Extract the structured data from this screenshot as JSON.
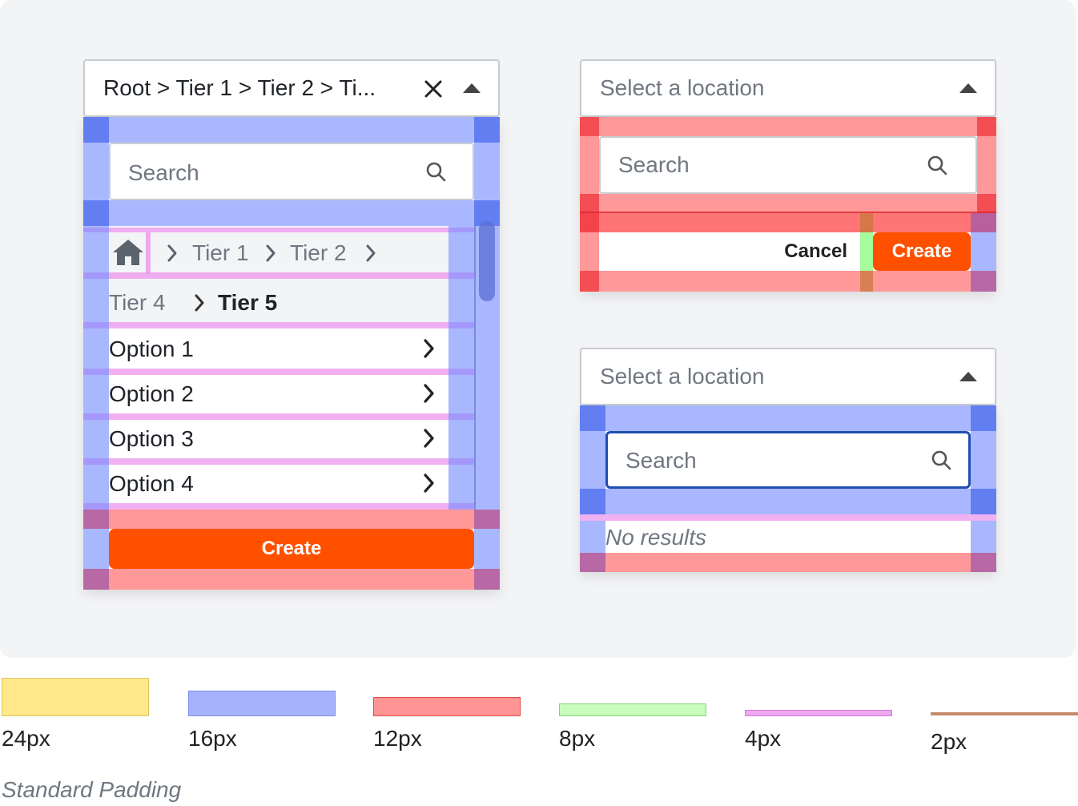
{
  "left_panel": {
    "trigger_value": "Root > Tier 1 > Tier 2 > Ti...",
    "search_placeholder": "Search",
    "breadcrumb": [
      "Tier 1",
      "Tier 2"
    ],
    "breadcrumb_row2": {
      "previous": "Tier 4",
      "current": "Tier 5"
    },
    "options": [
      "Option 1",
      "Option 2",
      "Option 3",
      "Option 4"
    ],
    "create_label": "Create"
  },
  "top_right_panel": {
    "trigger_placeholder": "Select a location",
    "search_placeholder": "Search",
    "cancel_label": "Cancel",
    "create_label": "Create"
  },
  "bottom_right_panel": {
    "trigger_placeholder": "Select a location",
    "search_placeholder": "Search",
    "empty_message": "No results"
  },
  "legend": {
    "items": [
      {
        "label": "24px",
        "color": "#ffe98a"
      },
      {
        "label": "16px",
        "color": "#a6b2fb"
      },
      {
        "label": "12px",
        "color": "#ff9494"
      },
      {
        "label": "8px",
        "color": "#c7fcbc"
      },
      {
        "label": "4px",
        "color": "#eea8f0"
      },
      {
        "label": "2px",
        "color": "#c58a6a"
      }
    ],
    "caption": "Standard Padding"
  },
  "colors": {
    "accent": "#ff5000",
    "focus": "#1e4fb0",
    "panel_bg": "#f3f4f6"
  },
  "icons": [
    "close-icon",
    "caret-up-icon",
    "search-icon",
    "home-icon",
    "chevron-right-icon"
  ]
}
